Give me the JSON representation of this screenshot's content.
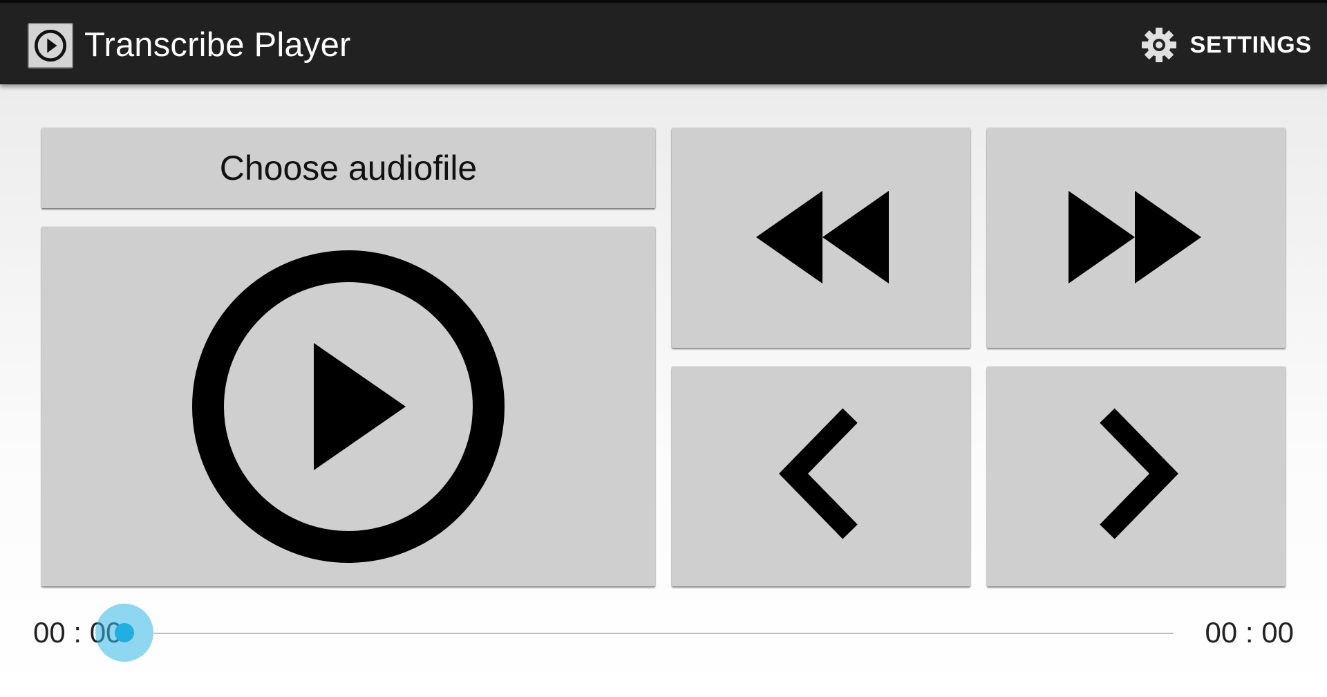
{
  "app_bar": {
    "title": "Transcribe Player",
    "app_icon": "play-circle-icon",
    "settings_icon": "gear-icon",
    "settings_label": "SETTINGS",
    "background_color": "#212121"
  },
  "controls": {
    "choose_file_label": "Choose audiofile",
    "play_icon": "play-circle-icon",
    "rewind_icon": "rewind-icon",
    "fast_forward_icon": "fast-forward-icon",
    "previous_icon": "chevron-left-icon",
    "next_icon": "chevron-right-icon",
    "button_color": "#cfcfcf"
  },
  "seek_bar": {
    "current_time": "00 : 00",
    "total_time": "00 : 00",
    "progress_fraction": 0,
    "accent_color": "#33b5e5"
  }
}
